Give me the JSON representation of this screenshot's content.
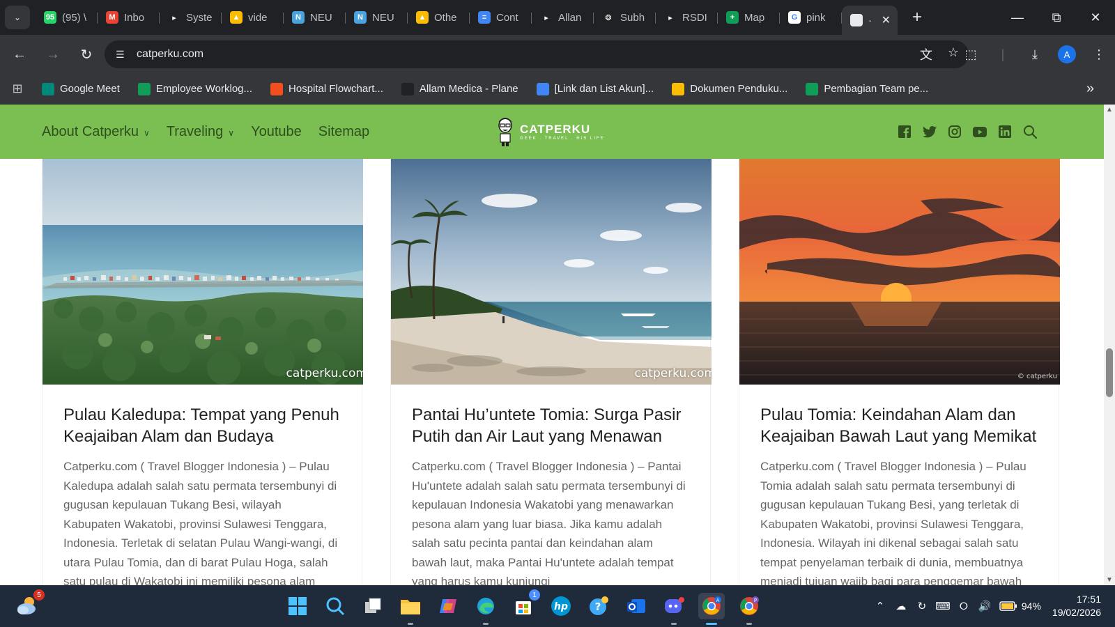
{
  "browser": {
    "tabs": [
      {
        "title": "(95) \\",
        "icon": "whatsapp-icon",
        "color": "#25d366",
        "glyph": "95"
      },
      {
        "title": "Inbo",
        "icon": "gmail-icon",
        "color": "#ea4335",
        "glyph": "M"
      },
      {
        "title": "Syste",
        "icon": "clickup-icon",
        "color": "#202124",
        "glyph": "▸"
      },
      {
        "title": "vide",
        "icon": "drive-icon",
        "color": "#fbbc04",
        "glyph": "▲"
      },
      {
        "title": "NEU",
        "icon": "neu-icon",
        "color": "#4aa3df",
        "glyph": "N"
      },
      {
        "title": "NEU",
        "icon": "neu-icon",
        "color": "#4aa3df",
        "glyph": "N"
      },
      {
        "title": "Othe",
        "icon": "drive-icon",
        "color": "#fbbc04",
        "glyph": "▲"
      },
      {
        "title": "Cont",
        "icon": "docs-icon",
        "color": "#4285f4",
        "glyph": "≡"
      },
      {
        "title": "Allan",
        "icon": "clickup-icon",
        "color": "#202124",
        "glyph": "▸"
      },
      {
        "title": "Subh",
        "icon": "chatgpt-icon",
        "color": "#202124",
        "glyph": "❂"
      },
      {
        "title": "RSDI",
        "icon": "clickup-icon",
        "color": "#202124",
        "glyph": "▸"
      },
      {
        "title": "Map",
        "icon": "sheets-icon",
        "color": "#0f9d58",
        "glyph": "+"
      },
      {
        "title": "pink",
        "icon": "google-icon",
        "color": "#ffffff",
        "glyph": "G"
      }
    ],
    "active_tab": {
      "title": "·"
    },
    "url": "catperku.com",
    "profile_initial": "A",
    "bookmarks": [
      {
        "label": "Google Meet",
        "icon": "meet-icon",
        "color": "#00897b"
      },
      {
        "label": "Employee Worklog...",
        "icon": "sheets-icon",
        "color": "#0f9d58"
      },
      {
        "label": "Hospital Flowchart...",
        "icon": "figma-icon",
        "color": "#f24e1e"
      },
      {
        "label": "Allam Medica - Plane",
        "icon": "clickup-icon",
        "color": "#202124"
      },
      {
        "label": "[Link dan List Akun]...",
        "icon": "docs-icon",
        "color": "#4285f4"
      },
      {
        "label": "Dokumen Penduku...",
        "icon": "drive-icon",
        "color": "#fbbc04"
      },
      {
        "label": "Pembagian Team pe...",
        "icon": "sheets-icon",
        "color": "#0f9d58"
      }
    ]
  },
  "site": {
    "nav": [
      {
        "label": "About Catperku",
        "has_dropdown": true
      },
      {
        "label": "Traveling",
        "has_dropdown": true
      },
      {
        "label": "Youtube",
        "has_dropdown": false
      },
      {
        "label": "Sitemap",
        "has_dropdown": false
      }
    ],
    "logo_text": "CATPERKU",
    "logo_tagline": "GEEK . TRAVEL . HIS LIFE",
    "header_color": "#7bbf52",
    "social": [
      "facebook-icon",
      "twitter-icon",
      "instagram-icon",
      "youtube-icon",
      "linkedin-icon",
      "search-icon"
    ]
  },
  "articles": [
    {
      "title": "Pulau Kaledupa: Tempat yang Penuh Keajaiban Alam dan Budaya",
      "excerpt": "Catperku.com ( Travel Blogger Indonesia ) – Pulau Kaledupa adalah salah satu permata tersembunyi di gugusan kepulauan Tukang Besi, wilayah Kabupaten Wakatobi, provinsi Sulawesi Tenggara, Indonesia. Terletak di selatan Pulau Wangi-wangi, di utara Pulau Tomia, dan di barat Pulau Hoga, salah satu pulau di Wakatobi ini memiliki pesona alam",
      "watermark": "catperku.com"
    },
    {
      "title": "Pantai Hu’untete Tomia: Surga Pasir Putih dan Air Laut yang Menawan",
      "excerpt": "Catperku.com ( Travel Blogger Indonesia ) – Pantai Hu'untete adalah salah satu permata tersembunyi di kepulauan Indonesia Wakatobi yang menawarkan pesona alam yang luar biasa. Jika kamu adalah salah satu pecinta pantai dan keindahan alam bawah laut, maka Pantai Hu'untete adalah tempat yang harus kamu kunjungi",
      "watermark": "catperku.com"
    },
    {
      "title": "Pulau Tomia: Keindahan Alam dan Keajaiban Bawah Laut yang Memikat",
      "excerpt": "Catperku.com ( Travel Blogger Indonesia ) – Pulau Tomia adalah salah satu permata tersembunyi di gugusan kepulauan Tukang Besi, yang terletak di Kabupaten Wakatobi, provinsi Sulawesi Tenggara, Indonesia. Wilayah ini dikenal sebagai salah satu tempat penyelaman terbaik di dunia, membuatnya menjadi tujuan wajib bagi para penggemar bawah",
      "watermark": "© catperku"
    }
  ],
  "taskbar": {
    "weather_badge": "5",
    "store_badge": "1",
    "battery": "94%",
    "time": "17:51",
    "date": "19/02/2026"
  }
}
